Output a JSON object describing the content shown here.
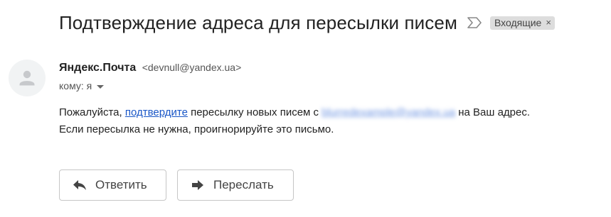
{
  "email": {
    "subject": "Подтверждение адреса для пересылки писем",
    "label": "Входящие",
    "label_remove": "×",
    "sender_name": "Яндекс.Почта",
    "sender_email": "<devnull@yandex.ua>",
    "recipient": "кому: я",
    "body": {
      "line1_before": "Пожалуйста, ",
      "link_text": "подтвердите",
      "line1_middle": " пересылку новых писем с ",
      "blurred_address": "blurredexample@yandex.ua",
      "line1_after": " на Ваш адрес.",
      "line2": "Если пересылка не нужна, проигнорируйте это письмо."
    }
  },
  "actions": {
    "reply_label": "Ответить",
    "forward_label": "Переслать"
  },
  "icons": {
    "importance": "importance-marker-icon",
    "avatar": "person-icon",
    "reply": "reply-arrow-icon",
    "forward": "forward-arrow-icon",
    "caret": "caret-down-icon"
  },
  "colors": {
    "link": "#1a57c7",
    "label_bg": "#dddddd",
    "avatar_bg": "#f1f3f4"
  }
}
